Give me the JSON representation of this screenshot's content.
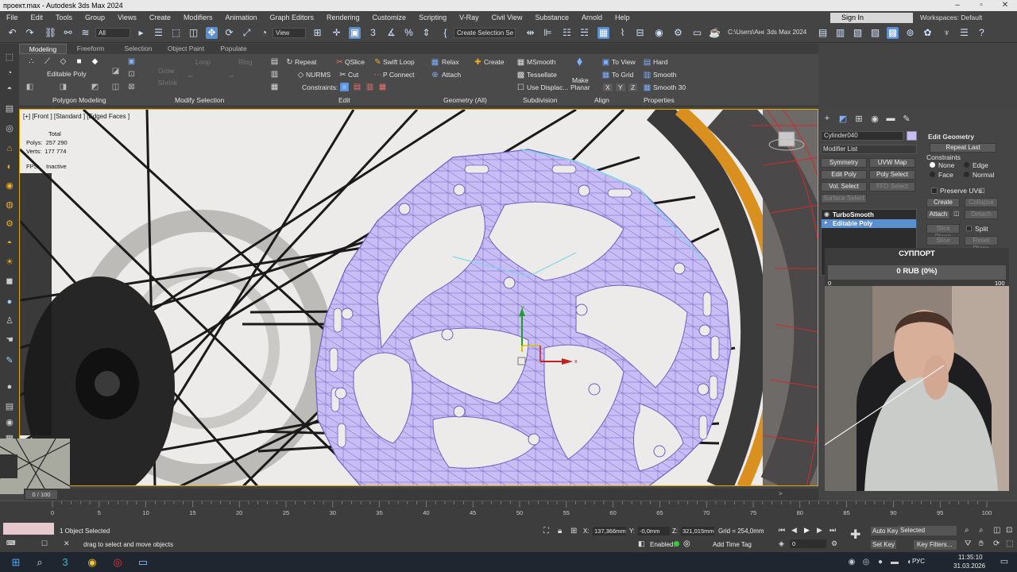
{
  "window": {
    "title": "проект.max - Autodesk 3ds Max 2024"
  },
  "menu": [
    "File",
    "Edit",
    "Tools",
    "Group",
    "Views",
    "Create",
    "Modifiers",
    "Animation",
    "Graph Editors",
    "Rendering",
    "Customize",
    "Scripting",
    "V-Ray",
    "Civil View",
    "Substance",
    "Arnold",
    "Help"
  ],
  "account": {
    "sign_in": "Sign In",
    "workspaces": "Workspaces: Default"
  },
  "toolbar": {
    "filter": "All",
    "view": "View",
    "selection_set": "Create Selection Se",
    "path": "C:\\Users\\Ане",
    "project": "3ds Max 2024"
  },
  "ribbon": {
    "tabs": [
      "Modeling",
      "Freeform",
      "Selection",
      "Object Paint",
      "Populate"
    ],
    "editable_poly": "Editable Poly",
    "grow": "Grow",
    "shrink": "Shrink",
    "loop": "Loop",
    "ring": "Ring",
    "repeat": "Repeat",
    "qslice": "QSlice",
    "swift_loop": "Swift Loop",
    "nurms": "NURMS",
    "cut": "Cut",
    "p_connect": "P Connect",
    "constraints": "Constraints:",
    "relax": "Relax",
    "create": "Create",
    "attach": "Attach",
    "msmooth": "MSmooth",
    "tessellate": "Tessellate",
    "use_displace": "Use Displac...",
    "make_planar_1": "Make",
    "make_planar_2": "Planar",
    "to_view": "To View",
    "to_grid": "To Grid",
    "x": "X",
    "y": "Y",
    "z": "Z",
    "hard": "Hard",
    "smooth": "Smooth",
    "smooth30": "Smooth 30",
    "sections": {
      "polygon_modeling": "Polygon Modeling",
      "modify_selection": "Modify Selection",
      "edit": "Edit",
      "geometry": "Geometry (All)",
      "subdivision": "Subdivision",
      "align": "Align",
      "properties": "Properties"
    }
  },
  "viewport": {
    "label": "[+] [Front ] [Standard ] [Edged Faces ]",
    "stats_total": "Total",
    "stats_polys": "Polys:  257 290",
    "stats_verts": "Verts:  177 774",
    "stats_fps": "FPS:    Inactive",
    "gizmo_y": "y",
    "gizmo_x": "x"
  },
  "command_panel": {
    "object_name": "Cylinder040",
    "modifier_list": "Modifier List",
    "buttons": [
      "Symmetry",
      "UVW Map",
      "Edit Poly",
      "Poly Select",
      "Vol. Select",
      "FFD Select",
      "Surface Select"
    ],
    "stack": [
      "TurboSmooth",
      "Editable Poly"
    ],
    "edit_geometry": {
      "title": "Edit Geometry",
      "repeat_last": "Repeat Last",
      "constraints": "Constraints",
      "none": "None",
      "edge": "Edge",
      "face": "Face",
      "normal": "Normal",
      "preserve_uvs": "Preserve UVs",
      "create": "Create",
      "collapse": "Collapse",
      "attach": "Attach",
      "detach": "Detach",
      "slice_plane": "Slice Plane",
      "split": "Split",
      "slice": "Slice",
      "reset_plane": "Reset Plane"
    }
  },
  "donation": {
    "title": "СУППОРТ",
    "amount": "0 RUB (0%)",
    "min": "0",
    "max": "100"
  },
  "timeline": {
    "frame": "0 / 100",
    "ticks": [
      "0",
      "5",
      "10",
      "15",
      "20",
      "25",
      "30",
      "35",
      "40",
      "45",
      "50",
      "55",
      "60",
      "65",
      "70",
      "75",
      "80",
      "85",
      "90",
      "95",
      "100"
    ]
  },
  "status": {
    "selected": "1 Object Selected",
    "hint": "drag to select and move objects",
    "x": "137,366mm",
    "y": "-0,0mm",
    "z": "321,015mm",
    "grid": "Grid = 254,0mm",
    "enabled": "Enabled:",
    "add_time_tag": "Add Time Tag",
    "frame_value": "0",
    "auto_key": "Auto Key",
    "selected_dd": "Selected",
    "set_key": "Set Key",
    "key_filters": "Key Filters..."
  },
  "taskbar": {
    "lang": "РУС",
    "time": "11:35:10",
    "date": "31.03.2026"
  },
  "colors": {
    "mesh_fill": "#c9bdf5",
    "mesh_line": "#6f5fc0",
    "accent": "#5a8fd0",
    "selection_yellow": "#e0a800",
    "rim_orange": "#d9901e"
  }
}
